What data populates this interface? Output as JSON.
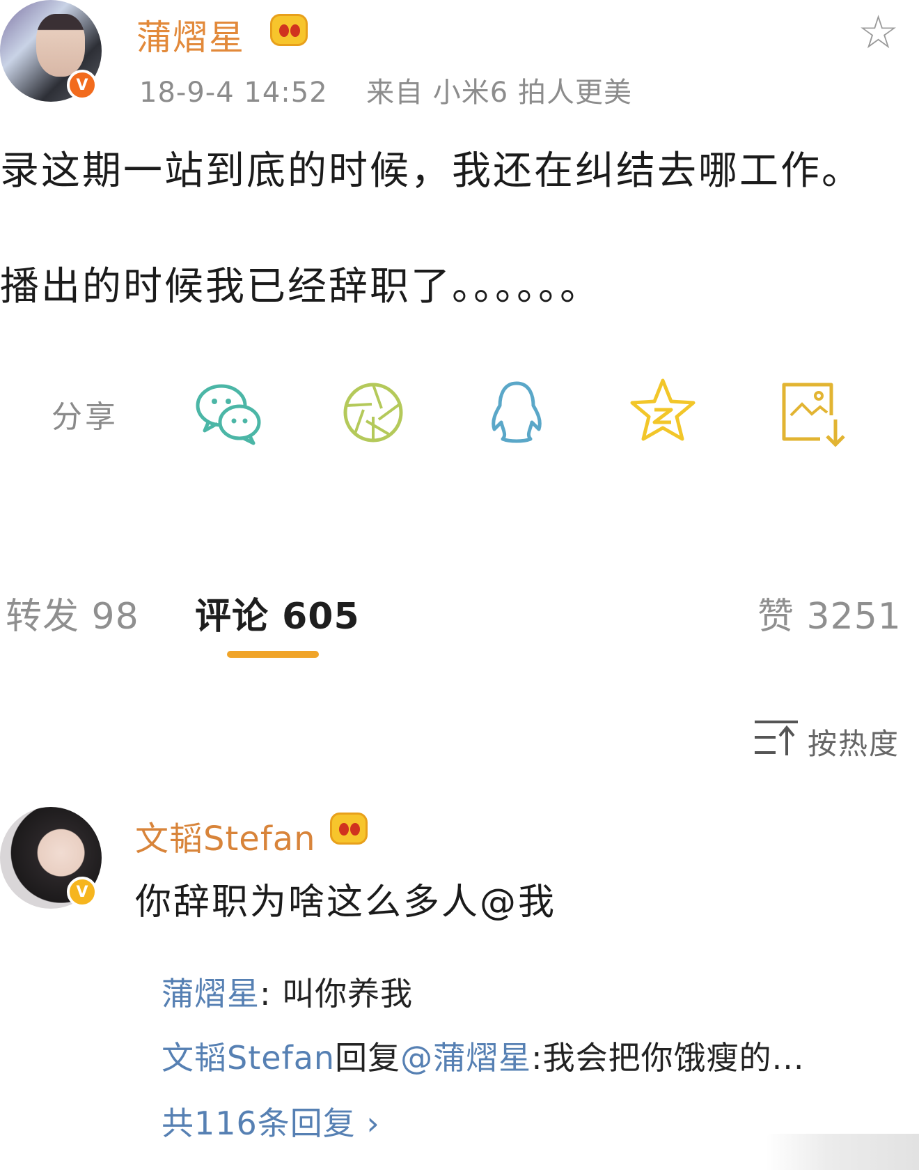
{
  "post": {
    "username": "蒲熠星",
    "time": "18-9-4 14:52",
    "source": "来自 小米6 拍人更美",
    "text_lines": [
      "录这期一站到底的时候，我还在纠结去哪工作。",
      "播出的时候我已经辞职了。。。。。。"
    ]
  },
  "share": {
    "label": "分享",
    "icons": [
      "wechat-icon",
      "moments-icon",
      "qq-icon",
      "qzone-icon",
      "save-image-icon"
    ],
    "colors": {
      "wechat": "#4bb6a6",
      "moments": "#b4c95a",
      "qq": "#5aa7c8",
      "qzone": "#f2c629",
      "save": "#e2b432"
    }
  },
  "tabs": {
    "repost": "转发 98",
    "comments": "评论 605",
    "likes": "赞 3251"
  },
  "sort": {
    "label": "按热度"
  },
  "comment": {
    "username": "文韬Stefan",
    "text": "你辞职为啥这么多人@我",
    "replies": [
      {
        "user": "蒲熠星",
        "sep": ": ",
        "text": "叫你养我"
      },
      {
        "user": "文韬Stefan",
        "mid": "回复",
        "mention": "@蒲熠星",
        "sep": ":",
        "text": "我会把你饿瘦的..."
      }
    ],
    "more": "共116条回复 ›"
  },
  "colors": {
    "accent": "#f0a429",
    "username": "#e2893a",
    "link": "#5680b3",
    "verified_orange": "#f26b1d",
    "verified_yellow": "#f6b51e"
  }
}
